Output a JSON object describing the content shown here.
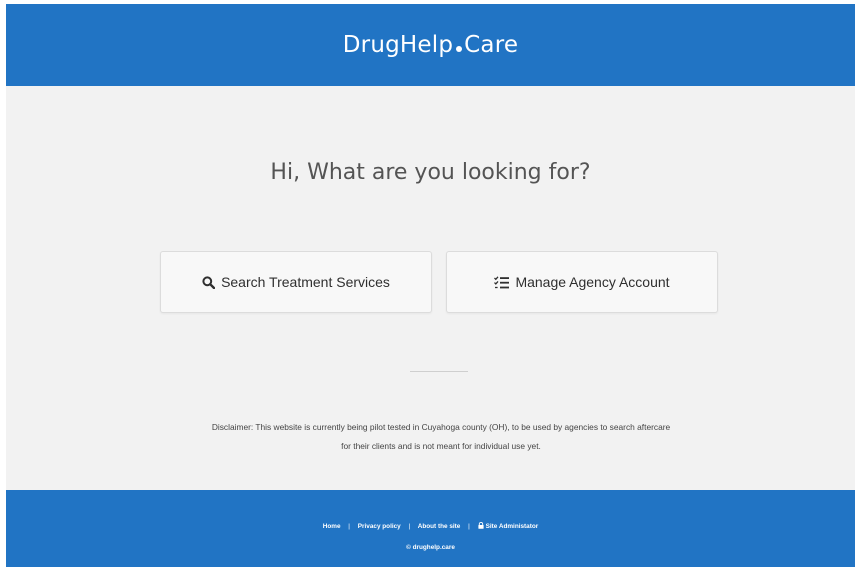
{
  "header": {
    "brand_left": "DrugHelp",
    "brand_right": "Care"
  },
  "main": {
    "headline": "Hi, What are you looking for?",
    "buttons": [
      {
        "label": "Search Treatment Services",
        "icon": "search-icon"
      },
      {
        "label": "Manage Agency Account",
        "icon": "checklist-icon"
      }
    ],
    "disclaimer_line1": "Disclaimer: This website is currently being pilot tested in Cuyahoga county (OH), to be used by agencies to search aftercare",
    "disclaimer_line2": "for their clients and is not meant for individual use yet."
  },
  "footer": {
    "links": [
      "Home",
      "Privacy policy",
      "About the site",
      "Site Administator"
    ],
    "separator": "|",
    "copyright": "© drughelp.care"
  },
  "colors": {
    "brand_blue": "#2174c4",
    "page_bg": "#f2f2f2"
  }
}
